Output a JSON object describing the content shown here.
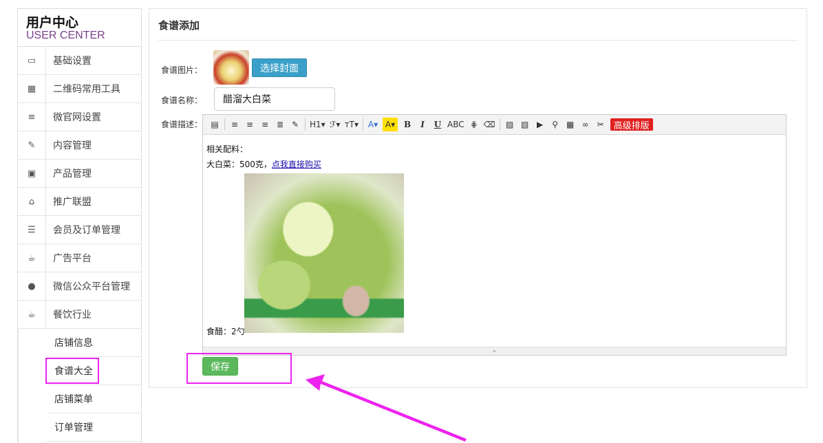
{
  "sidebar": {
    "title": "用户中心",
    "subtitle": "USER CENTER",
    "items": [
      {
        "label": "基础设置",
        "icon": "monitor-icon",
        "glyph": "▭"
      },
      {
        "label": "二维码常用工具",
        "icon": "qrcode-icon",
        "glyph": "▦"
      },
      {
        "label": "微官网设置",
        "icon": "list-icon",
        "glyph": "≡"
      },
      {
        "label": "内容管理",
        "icon": "edit-icon",
        "glyph": "✎"
      },
      {
        "label": "产品管理",
        "icon": "image-icon",
        "glyph": "▣"
      },
      {
        "label": "推广联盟",
        "icon": "gift-icon",
        "glyph": "⌂"
      },
      {
        "label": "会员及订单管理",
        "icon": "database-icon",
        "glyph": "☰"
      },
      {
        "label": "广告平台",
        "icon": "coffee-icon",
        "glyph": "☕"
      },
      {
        "label": "微信公众平台管理",
        "icon": "chat-icon",
        "glyph": "●"
      },
      {
        "label": "餐饮行业",
        "icon": "coffee-icon",
        "glyph": "☕"
      }
    ],
    "subitems": [
      "店铺信息",
      "食谱大全",
      "店铺菜单",
      "订单管理"
    ]
  },
  "panel": {
    "title": "食谱添加",
    "cover_label": "食谱图片：",
    "cover_button": "选择封面",
    "name_label": "食谱名称：",
    "name_value": "醋溜大白菜",
    "desc_label": "食谱描述：",
    "save_label": "保存"
  },
  "editor": {
    "toolbar": [
      {
        "name": "source-icon",
        "text": "▤"
      },
      {
        "name": "sep"
      },
      {
        "name": "align-left-icon",
        "text": "≡"
      },
      {
        "name": "align-center-icon",
        "text": "≡"
      },
      {
        "name": "align-right-icon",
        "text": "≡"
      },
      {
        "name": "align-justify-icon",
        "text": "≣"
      },
      {
        "name": "format-brush-icon",
        "text": "✎"
      },
      {
        "name": "sep"
      },
      {
        "name": "heading-icon",
        "text": "H1▾"
      },
      {
        "name": "font-family-icon",
        "text": "ℱ▾"
      },
      {
        "name": "font-size-icon",
        "text": "тT▾"
      },
      {
        "name": "sep"
      },
      {
        "name": "font-color-icon",
        "text": "A▾",
        "cls": "fcolor"
      },
      {
        "name": "background-color-icon",
        "text": "A▾",
        "cls": "bcolor"
      },
      {
        "name": "bold-icon",
        "text": "B",
        "cls": "bold"
      },
      {
        "name": "italic-icon",
        "text": "I",
        "cls": "ital"
      },
      {
        "name": "underline-icon",
        "text": "U",
        "cls": "und"
      },
      {
        "name": "strikethrough-icon",
        "text": "ABC"
      },
      {
        "name": "horizontal-rule-icon",
        "text": "⋕"
      },
      {
        "name": "eraser-icon",
        "text": "⌫"
      },
      {
        "name": "sep"
      },
      {
        "name": "insert-image-icon",
        "text": "▨"
      },
      {
        "name": "multi-image-icon",
        "text": "▧"
      },
      {
        "name": "video-icon",
        "text": "▶"
      },
      {
        "name": "attachment-icon",
        "text": "⚲"
      },
      {
        "name": "table-icon",
        "text": "▦"
      },
      {
        "name": "link-icon",
        "text": "∞"
      },
      {
        "name": "unlink-icon",
        "text": "✂"
      },
      {
        "name": "advanced-layout-button",
        "text": "高级排版",
        "cls": "adv"
      }
    ],
    "line1": "相关配料：",
    "line2_prefix": "大白菜：500克，",
    "line2_link": "点我直接购买",
    "line3": "食醋：2勺",
    "resize_glyph": "÷"
  }
}
